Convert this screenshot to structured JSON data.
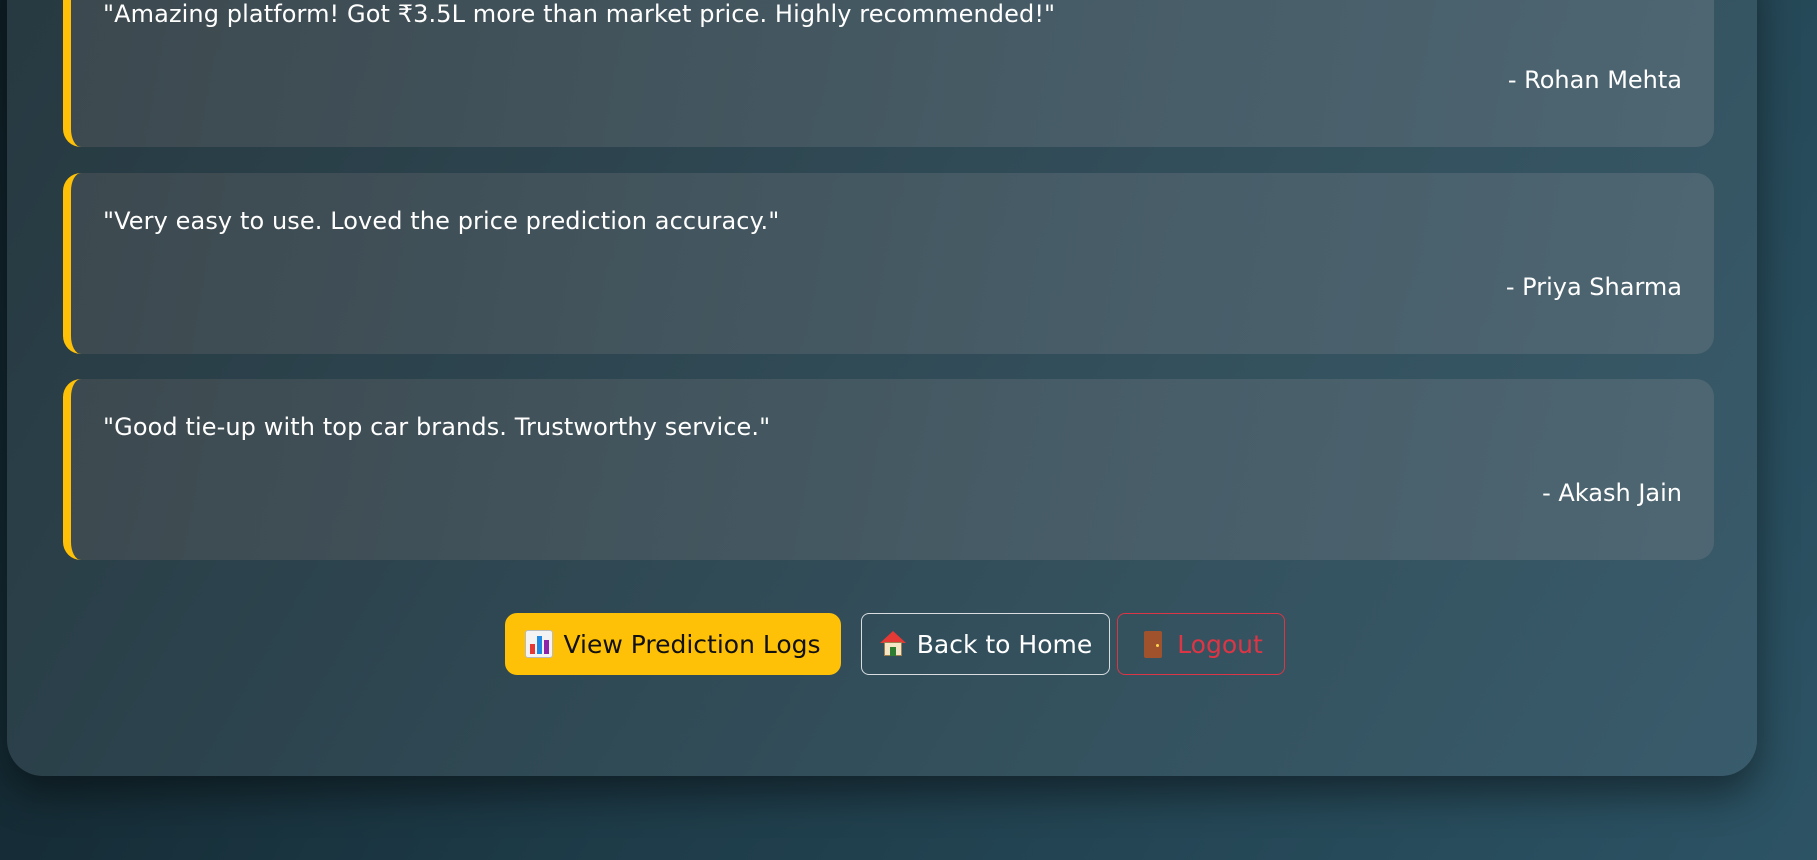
{
  "testimonials": [
    {
      "quote": "\"Amazing platform! Got ₹3.5L more than market price. Highly recommended!\"",
      "author": "- Rohan Mehta"
    },
    {
      "quote": "\"Very easy to use. Loved the price prediction accuracy.\"",
      "author": "- Priya Sharma"
    },
    {
      "quote": "\"Good tie-up with top car brands. Trustworthy service.\"",
      "author": "- Akash Jain"
    }
  ],
  "actions": {
    "logs_label": "View Prediction Logs",
    "logs_icon": "bar-chart-icon",
    "home_label": "Back to Home",
    "home_icon": "house-icon",
    "logout_label": "Logout",
    "logout_icon": "door-icon"
  },
  "colors": {
    "accent": "#ffc107",
    "danger": "#dc3545"
  }
}
